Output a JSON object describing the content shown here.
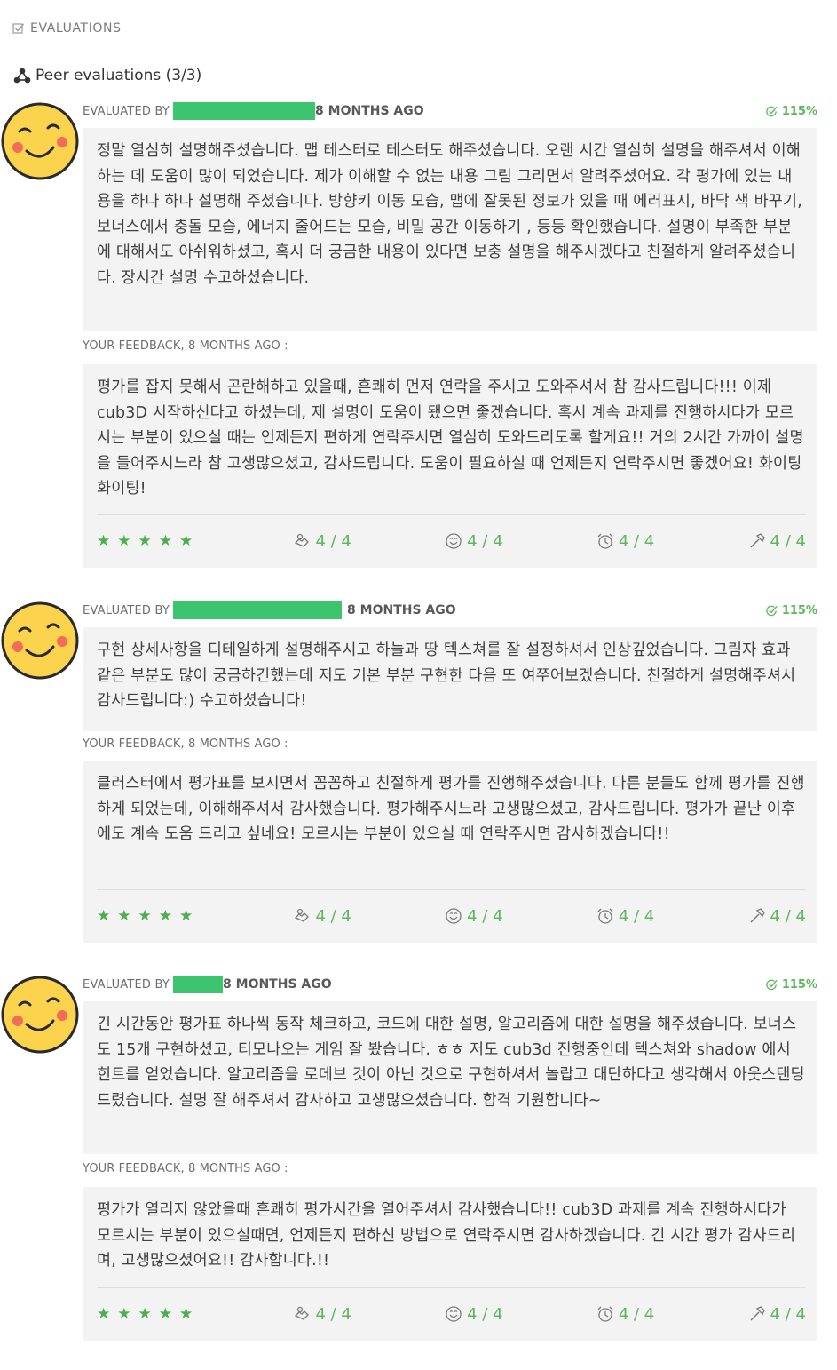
{
  "section_title": "EVALUATIONS",
  "peer_title": "Peer evaluations (3/3)",
  "colors": {
    "accent": "#5cb85c",
    "redaction": "#3cc46e",
    "box_bg": "#f3f3f3"
  },
  "evaluations": [
    {
      "evaluated_by": "EVALUATED BY",
      "time_ago": "8 MONTHS AGO",
      "score": "115%",
      "comment": "정말 열심히 설명해주셨습니다. 맵 테스터로 테스터도 해주셨습니다. 오랜 시간 열심히 설명을 해주셔서 이해하는 데 도움이 많이 되었습니다. 제가 이해할 수 없는 내용 그림 그리면서 알려주셨어요. 각 평가에 있는 내용을 하나 하나 설명해 주셨습니다. 방향키 이동 모습, 맵에 잘못된 정보가 있을 때 에러표시, 바닥 색 바꾸기, 보너스에서 충돌 모습, 에너지 줄어드는 모습, 비밀 공간 이동하기 , 등등 확인했습니다. 설명이 부족한 부분에 대해서도 아쉬워하셨고, 혹시 더 궁금한 내용이 있다면 보충 설명을 해주시겠다고 친절하게 알려주셨습니다. 장시간 설명 수고하셨습니다.",
      "feedback_label": "YOUR FEEDBACK, 8 MONTHS AGO :",
      "feedback": "평가를 잡지 못해서 곤란해하고 있을때, 흔쾌히 먼저 연락을 주시고 도와주셔서 참 감사드립니다!!! 이제 cub3D 시작하신다고 하셨는데, 제 설명이 도움이 됐으면 좋겠습니다. 혹시 계속 과제를 진행하시다가 모르시는 부분이 있으실 때는 언제든지 편하게 연락주시면 열심히 도와드리도록 할게요!! 거의 2시간 가까이 설명을 들어주시느라 참 고생많으셨고, 감사드립니다. 도움이 필요하실 때 언제든지 연락주시면 좋겠어요! 화이팅 화이팅!",
      "stars": "★★★★★",
      "ratings": {
        "nice": "4 / 4",
        "friendly": "4 / 4",
        "punctual": "4 / 4",
        "interested": "4 / 4"
      }
    },
    {
      "evaluated_by": "EVALUATED BY",
      "time_ago": "8 MONTHS AGO",
      "score": "115%",
      "comment": "구현 상세사항을 디테일하게 설명해주시고 하늘과 땅 텍스쳐를 잘 설정하셔서 인상깊었습니다. 그림자 효과 같은 부분도 많이 궁금하긴했는데 저도 기본 부분 구현한 다음 또 여쭈어보겠습니다. 친절하게 설명해주셔서 감사드립니다:) 수고하셨습니다!",
      "feedback_label": "YOUR FEEDBACK, 8 MONTHS AGO :",
      "feedback": "클러스터에서 평가표를 보시면서 꼼꼼하고 친절하게 평가를 진행해주셨습니다. 다른 분들도 함께 평가를 진행하게 되었는데, 이해해주셔서 감사했습니다. 평가해주시느라 고생많으셨고, 감사드립니다. 평가가 끝난 이후에도 계속 도움 드리고 싶네요! 모르시는 부분이 있으실 때 연락주시면 감사하겠습니다!!",
      "stars": "★★★★★",
      "ratings": {
        "nice": "4 / 4",
        "friendly": "4 / 4",
        "punctual": "4 / 4",
        "interested": "4 / 4"
      }
    },
    {
      "evaluated_by": "EVALUATED BY",
      "time_ago": "8 MONTHS AGO",
      "score": "115%",
      "comment": "긴 시간동안 평가표 하나씩 동작 체크하고, 코드에 대한 설명, 알고리즘에 대한 설명을 해주셨습니다. 보너스도 15개 구현하셨고, 티모나오는 게임 잘 봤습니다. ㅎㅎ 저도 cub3d 진행중인데 텍스쳐와 shadow 에서 힌트를 얻었습니다. 알고리즘을 로데브 것이 아닌 것으로 구현하셔서 놀랍고 대단하다고 생각해서 아웃스탠딩 드렸습니다. 설명 잘 해주셔서 감사하고 고생많으셨습니다. 합격 기원합니다~",
      "feedback_label": "YOUR FEEDBACK, 8 MONTHS AGO :",
      "feedback": "평가가 열리지 않았을때 흔쾌히 평가시간을 열어주셔서 감사했습니다!! cub3D 과제를 계속 진행하시다가 모르시는 부분이 있으실때면, 언제든지 편하신 방법으로 연락주시면 감사하겠습니다. 긴 시간 평가 감사드리며, 고생많으셨어요!! 감사합니다.!!",
      "stars": "★★★★★",
      "ratings": {
        "nice": "4 / 4",
        "friendly": "4 / 4",
        "punctual": "4 / 4",
        "interested": "4 / 4"
      }
    }
  ]
}
